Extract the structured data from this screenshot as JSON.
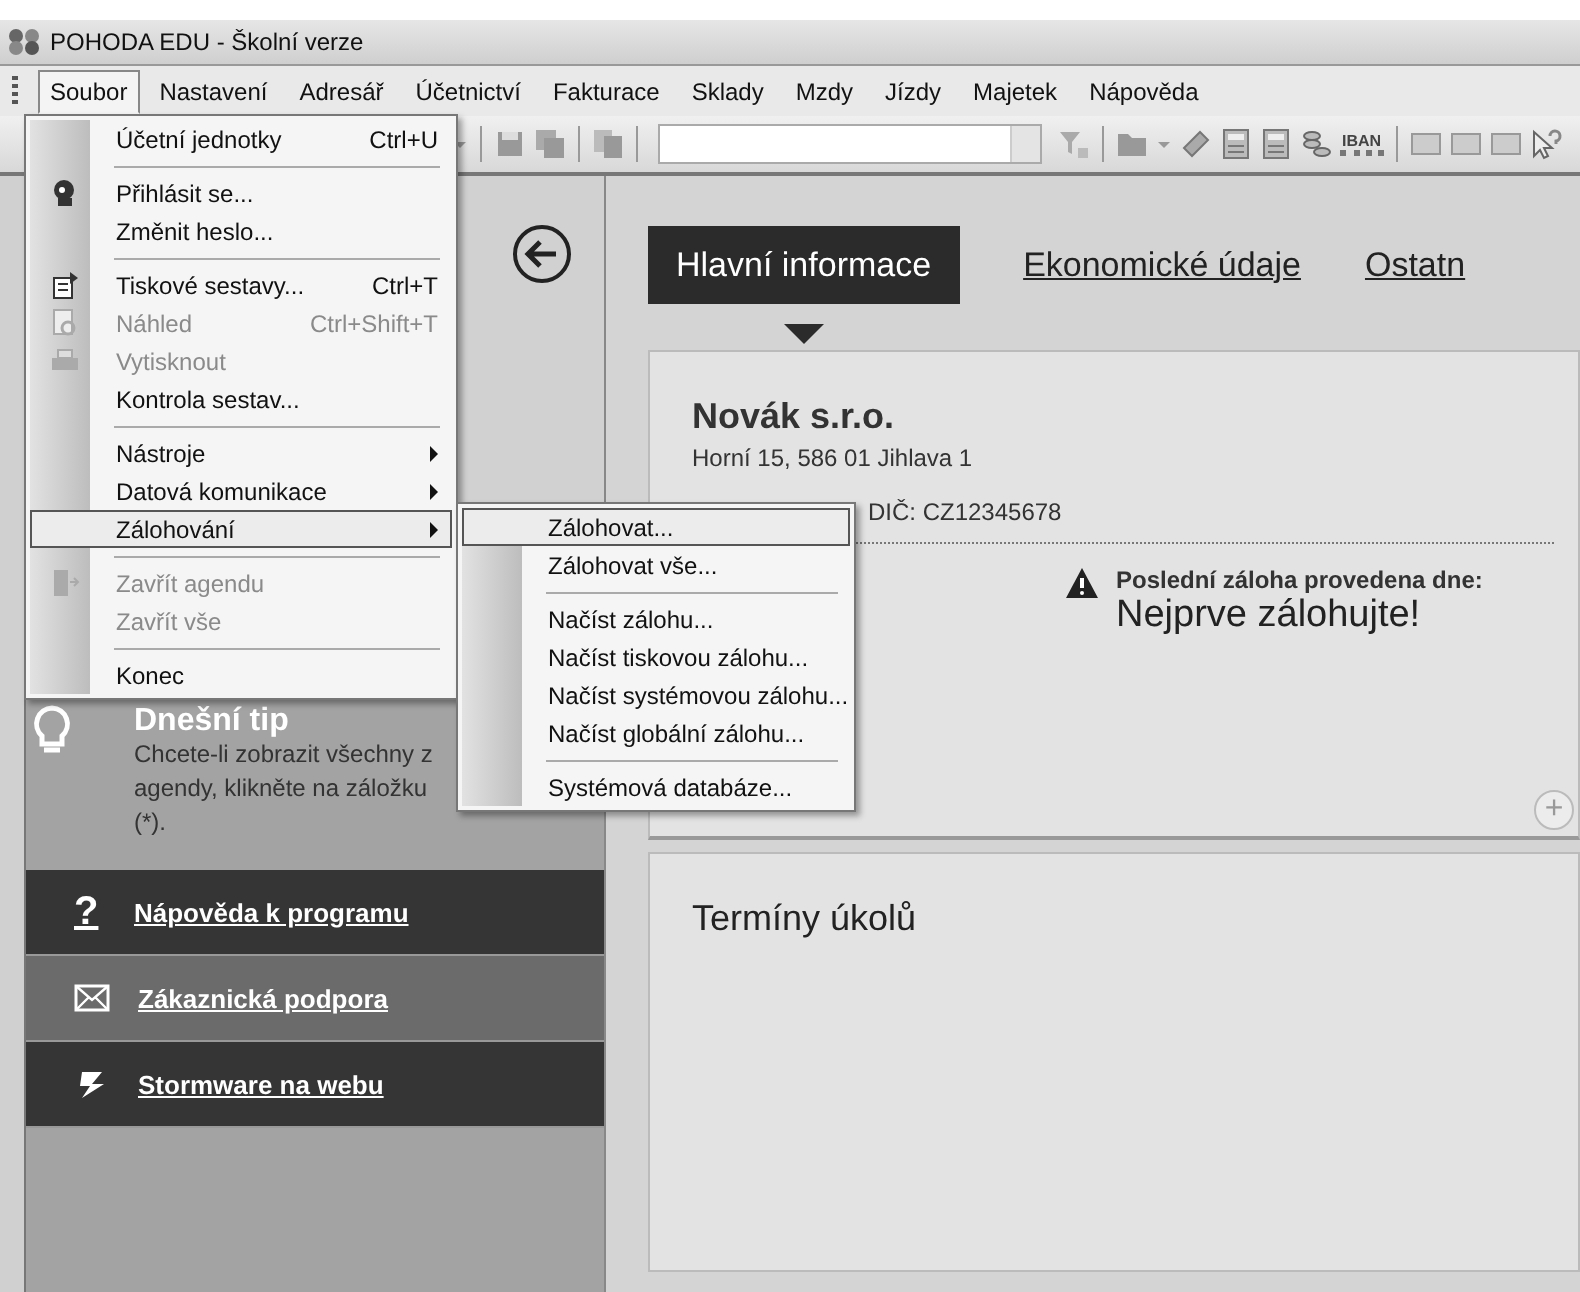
{
  "window": {
    "title": "POHODA EDU - Školní verze"
  },
  "menubar": [
    {
      "label": "Soubor",
      "selected": true
    },
    {
      "label": "Nastavení",
      "selected": false
    },
    {
      "label": "Adresář",
      "selected": false
    },
    {
      "label": "Účetnictví",
      "selected": false
    },
    {
      "label": "Fakturace",
      "selected": false
    },
    {
      "label": "Sklady",
      "selected": false
    },
    {
      "label": "Mzdy",
      "selected": false
    },
    {
      "label": "Jízdy",
      "selected": false
    },
    {
      "label": "Majetek",
      "selected": false
    },
    {
      "label": "Nápověda",
      "selected": false
    }
  ],
  "toolbar": [
    {
      "kind": "caret"
    },
    {
      "kind": "separator"
    },
    {
      "kind": "save"
    },
    {
      "kind": "save-all"
    },
    {
      "kind": "separator"
    },
    {
      "kind": "copy"
    },
    {
      "kind": "separator"
    },
    {
      "kind": "combo"
    },
    {
      "kind": "filter"
    },
    {
      "kind": "separator"
    },
    {
      "kind": "folder"
    },
    {
      "kind": "caret"
    },
    {
      "kind": "tag"
    },
    {
      "kind": "calculator"
    },
    {
      "kind": "calculator"
    },
    {
      "kind": "coins"
    },
    {
      "kind": "label",
      "label": "IBAN"
    },
    {
      "kind": "separator"
    },
    {
      "kind": "message"
    },
    {
      "kind": "message"
    },
    {
      "kind": "message"
    },
    {
      "kind": "help"
    }
  ],
  "file_menu": [
    {
      "kind": "item",
      "label": "Účetní jednotky",
      "shortcut": "Ctrl+U",
      "disabled": false,
      "selected": false,
      "submenu": false
    },
    {
      "kind": "separator"
    },
    {
      "kind": "item",
      "label": "Přihlásit se...",
      "disabled": false,
      "selected": false,
      "submenu": false
    },
    {
      "kind": "item",
      "label": "Změnit heslo...",
      "disabled": false,
      "selected": false,
      "submenu": false
    },
    {
      "kind": "separator"
    },
    {
      "kind": "item",
      "label": "Tiskové sestavy...",
      "shortcut": "Ctrl+T",
      "disabled": false,
      "selected": false,
      "submenu": false
    },
    {
      "kind": "item",
      "label": "Náhled",
      "shortcut": "Ctrl+Shift+T",
      "disabled": true,
      "selected": false,
      "submenu": false
    },
    {
      "kind": "item",
      "label": "Vytisknout",
      "disabled": true,
      "selected": false,
      "submenu": false
    },
    {
      "kind": "item",
      "label": "Kontrola sestav...",
      "disabled": false,
      "selected": false,
      "submenu": false
    },
    {
      "kind": "separator"
    },
    {
      "kind": "item",
      "label": "Nástroje",
      "disabled": false,
      "selected": false,
      "submenu": true
    },
    {
      "kind": "item",
      "label": "Datová komunikace",
      "disabled": false,
      "selected": false,
      "submenu": true
    },
    {
      "kind": "item",
      "label": "Zálohování",
      "disabled": false,
      "selected": true,
      "submenu": true
    },
    {
      "kind": "separator"
    },
    {
      "kind": "item",
      "label": "Zavřít agendu",
      "disabled": true,
      "selected": false,
      "submenu": false
    },
    {
      "kind": "item",
      "label": "Zavřít vše",
      "disabled": true,
      "selected": false,
      "submenu": false
    },
    {
      "kind": "separator"
    },
    {
      "kind": "item",
      "label": "Konec",
      "disabled": false,
      "selected": false,
      "submenu": false
    }
  ],
  "backup_submenu": [
    {
      "kind": "item",
      "label": "Zálohovat...",
      "selected": true
    },
    {
      "kind": "item",
      "label": "Zálohovat vše...",
      "selected": false
    },
    {
      "kind": "separator"
    },
    {
      "kind": "item",
      "label": "Načíst zálohu...",
      "selected": false
    },
    {
      "kind": "item",
      "label": "Načíst tiskovou zálohu...",
      "selected": false
    },
    {
      "kind": "item",
      "label": "Načíst systémovou zálohu...",
      "selected": false
    },
    {
      "kind": "item",
      "label": "Načíst globální zálohu...",
      "selected": false
    },
    {
      "kind": "separator"
    },
    {
      "kind": "item",
      "label": "Systémová databáze...",
      "selected": false
    }
  ],
  "sidebar": {
    "tip": {
      "title": "Dnešní tip",
      "text": "Chcete-li zobrazit všechny z agendy, klikněte na záložku (*)."
    },
    "links": [
      {
        "label": "Nápověda k programu",
        "glyph": "?",
        "selected": false
      },
      {
        "label": "Zákaznická podpora",
        "selected": true
      },
      {
        "label": "Stormware na webu",
        "selected": false
      }
    ]
  },
  "tabs": [
    {
      "label": "Hlavní informace",
      "selected": true
    },
    {
      "label": "Ekonomické údaje",
      "selected": false
    },
    {
      "label": "Ostatn",
      "selected": false
    }
  ],
  "company": {
    "name": "Novák s.r.o.",
    "address": "Horní 15, 586 01 Jihlava 1",
    "tax_id": "DIČ: CZ12345678",
    "backup_label": "Poslední záloha provedena dne:",
    "backup_value": "Nejprve zálohujte!",
    "add_button": "+"
  },
  "tasks": {
    "title": "Termíny úkolů"
  }
}
